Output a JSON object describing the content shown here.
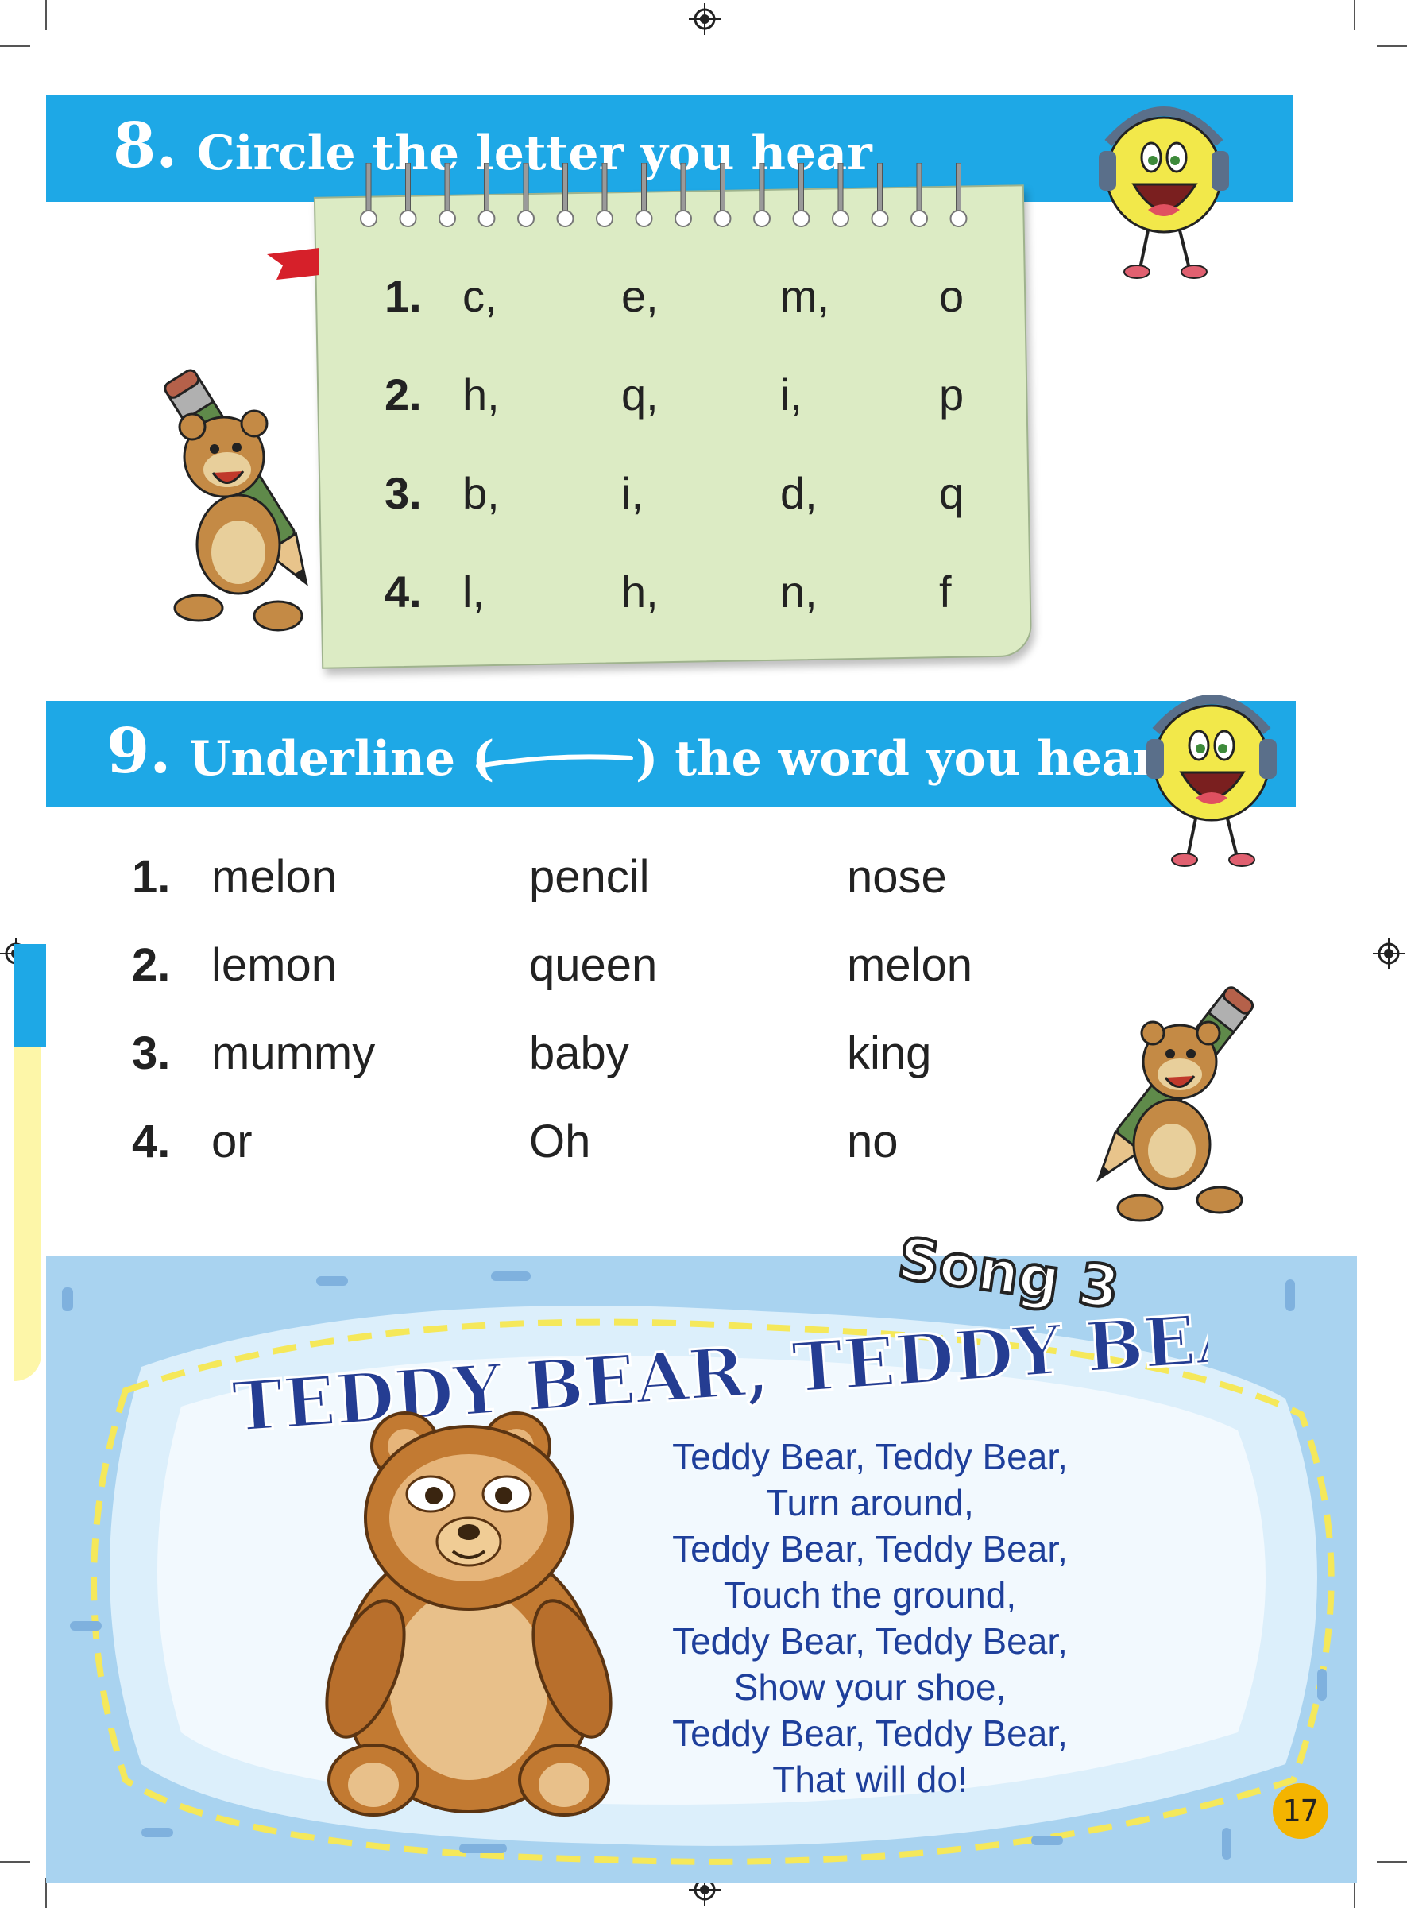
{
  "section8": {
    "number": "8.",
    "title": "Circle the letter you hear",
    "rows": [
      {
        "n": "1.",
        "letters": [
          "c,",
          "e,",
          "m,",
          "o"
        ]
      },
      {
        "n": "2.",
        "letters": [
          "h,",
          "q,",
          "i,",
          "p"
        ]
      },
      {
        "n": "3.",
        "letters": [
          "b,",
          "i,",
          "d,",
          "q"
        ]
      },
      {
        "n": "4.",
        "letters": [
          "l,",
          "h,",
          "n,",
          "f"
        ]
      }
    ]
  },
  "section9": {
    "number": "9.",
    "title_before": "Underline (",
    "title_after": ") the word you hear",
    "rows": [
      {
        "n": "1.",
        "words": [
          "melon",
          "pencil",
          "nose"
        ]
      },
      {
        "n": "2.",
        "words": [
          "lemon",
          "queen",
          "melon"
        ]
      },
      {
        "n": "3.",
        "words": [
          "mummy",
          "baby",
          "king"
        ]
      },
      {
        "n": "4.",
        "words": [
          "or",
          "Oh",
          "no"
        ]
      }
    ]
  },
  "song": {
    "badge": "Song 3",
    "title": "TEDDY BEAR, TEDDY BEAR",
    "lines": [
      "Teddy Bear, Teddy Bear,",
      "Turn around,",
      "Teddy Bear, Teddy Bear,",
      "Touch the ground,",
      "Teddy Bear, Teddy Bear,",
      "Show your shoe,",
      "Teddy Bear, Teddy Bear,",
      "That will do!"
    ]
  },
  "page_number": "17",
  "colors": {
    "banner": "#1ea8e6",
    "notebook": "#dcebc4",
    "song_bg": "#a9d3f0",
    "lyric_text": "#1e3f9b",
    "page_badge": "#f4b400"
  },
  "icons": [
    "registration-mark-icon",
    "smiley-headphones-icon",
    "bear-with-pencil-icon",
    "teddy-bear-icon",
    "red-ribbon-icon"
  ]
}
